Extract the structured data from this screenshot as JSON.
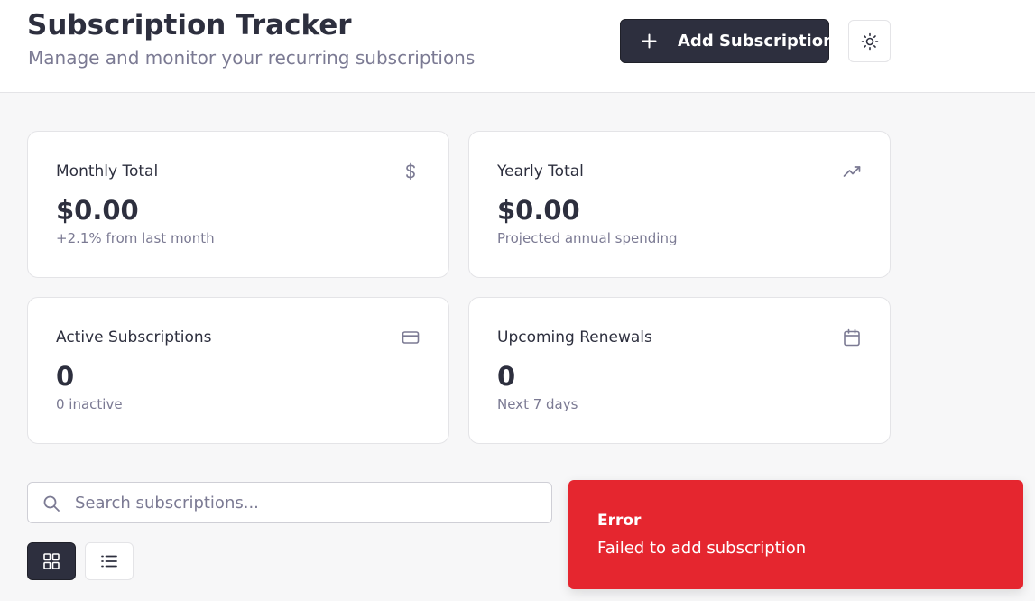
{
  "header": {
    "title": "Subscription Tracker",
    "subtitle": "Manage and monitor your recurring subscriptions",
    "add_button_label": "Add Subscription",
    "add_button_icon": "plus-icon",
    "theme_toggle_icon": "sun-icon"
  },
  "stats": [
    {
      "title": "Monthly Total",
      "value": "$0.00",
      "note": "+2.1% from last month",
      "icon": "dollar-icon"
    },
    {
      "title": "Yearly Total",
      "value": "$0.00",
      "note": "Projected annual spending",
      "icon": "trending-up-icon"
    },
    {
      "title": "Active Subscriptions",
      "value": "0",
      "note": "0 inactive",
      "icon": "credit-card-icon"
    },
    {
      "title": "Upcoming Renewals",
      "value": "0",
      "note": "Next 7 days",
      "icon": "calendar-icon"
    }
  ],
  "search": {
    "placeholder": "Search subscriptions...",
    "value": ""
  },
  "view_toggle": {
    "selected": "grid",
    "options": [
      "grid",
      "list"
    ]
  },
  "toast": {
    "title": "Error",
    "message": "Failed to add subscription"
  },
  "colors": {
    "primary": "#2d2f3e",
    "muted_text": "#7b7a93",
    "error": "#e5262f",
    "background": "#f7f7f8"
  }
}
